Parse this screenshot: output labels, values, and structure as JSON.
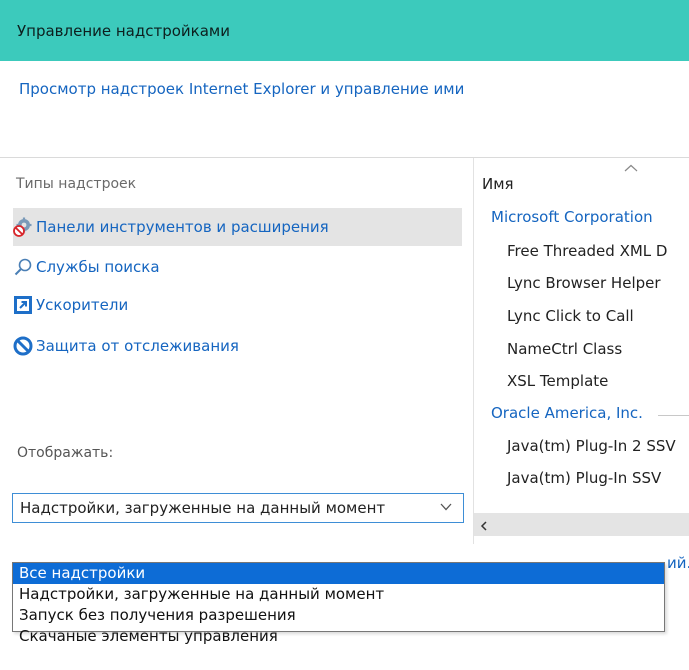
{
  "window": {
    "title": "Управление надстройками",
    "subtitle_link": "Просмотр надстроек Internet Explorer и управление ими"
  },
  "left_panel": {
    "section_label": "Типы надстроек",
    "types": [
      {
        "label": "Панели инструментов и расширения",
        "icon": "gear-icon",
        "selected": true
      },
      {
        "label": "Службы поиска",
        "icon": "search-icon",
        "selected": false
      },
      {
        "label": "Ускорители",
        "icon": "accelerator-icon",
        "selected": false
      },
      {
        "label": "Защита от отслеживания",
        "icon": "block-icon",
        "selected": false
      }
    ],
    "show_label": "Отображать:",
    "show_selected": "Надстройки, загруженные на данный момент"
  },
  "right_panel": {
    "column_header": "Имя",
    "groups": [
      {
        "name": "Microsoft Corporation",
        "items": [
          "Free Threaded XML D",
          "Lync Browser Helper",
          "Lync Click to Call",
          "NameCtrl Class",
          "XSL Template"
        ]
      },
      {
        "name": "Oracle America, Inc.",
        "items": [
          "Java(tm) Plug-In 2 SSV",
          "Java(tm) Plug-In SSV"
        ]
      }
    ]
  },
  "partial_text": "ий.",
  "dropdown": {
    "options": [
      "Все надстройки",
      "Надстройки, загруженные на данный момент",
      "Запуск без получения разрешения",
      "Скачаные элементы управления"
    ],
    "highlighted_index": 0
  },
  "colors": {
    "titlebar": "#3ccabc",
    "link": "#1565c0",
    "selection": "#0d6cd6",
    "selected_row": "#e4e4e4"
  }
}
